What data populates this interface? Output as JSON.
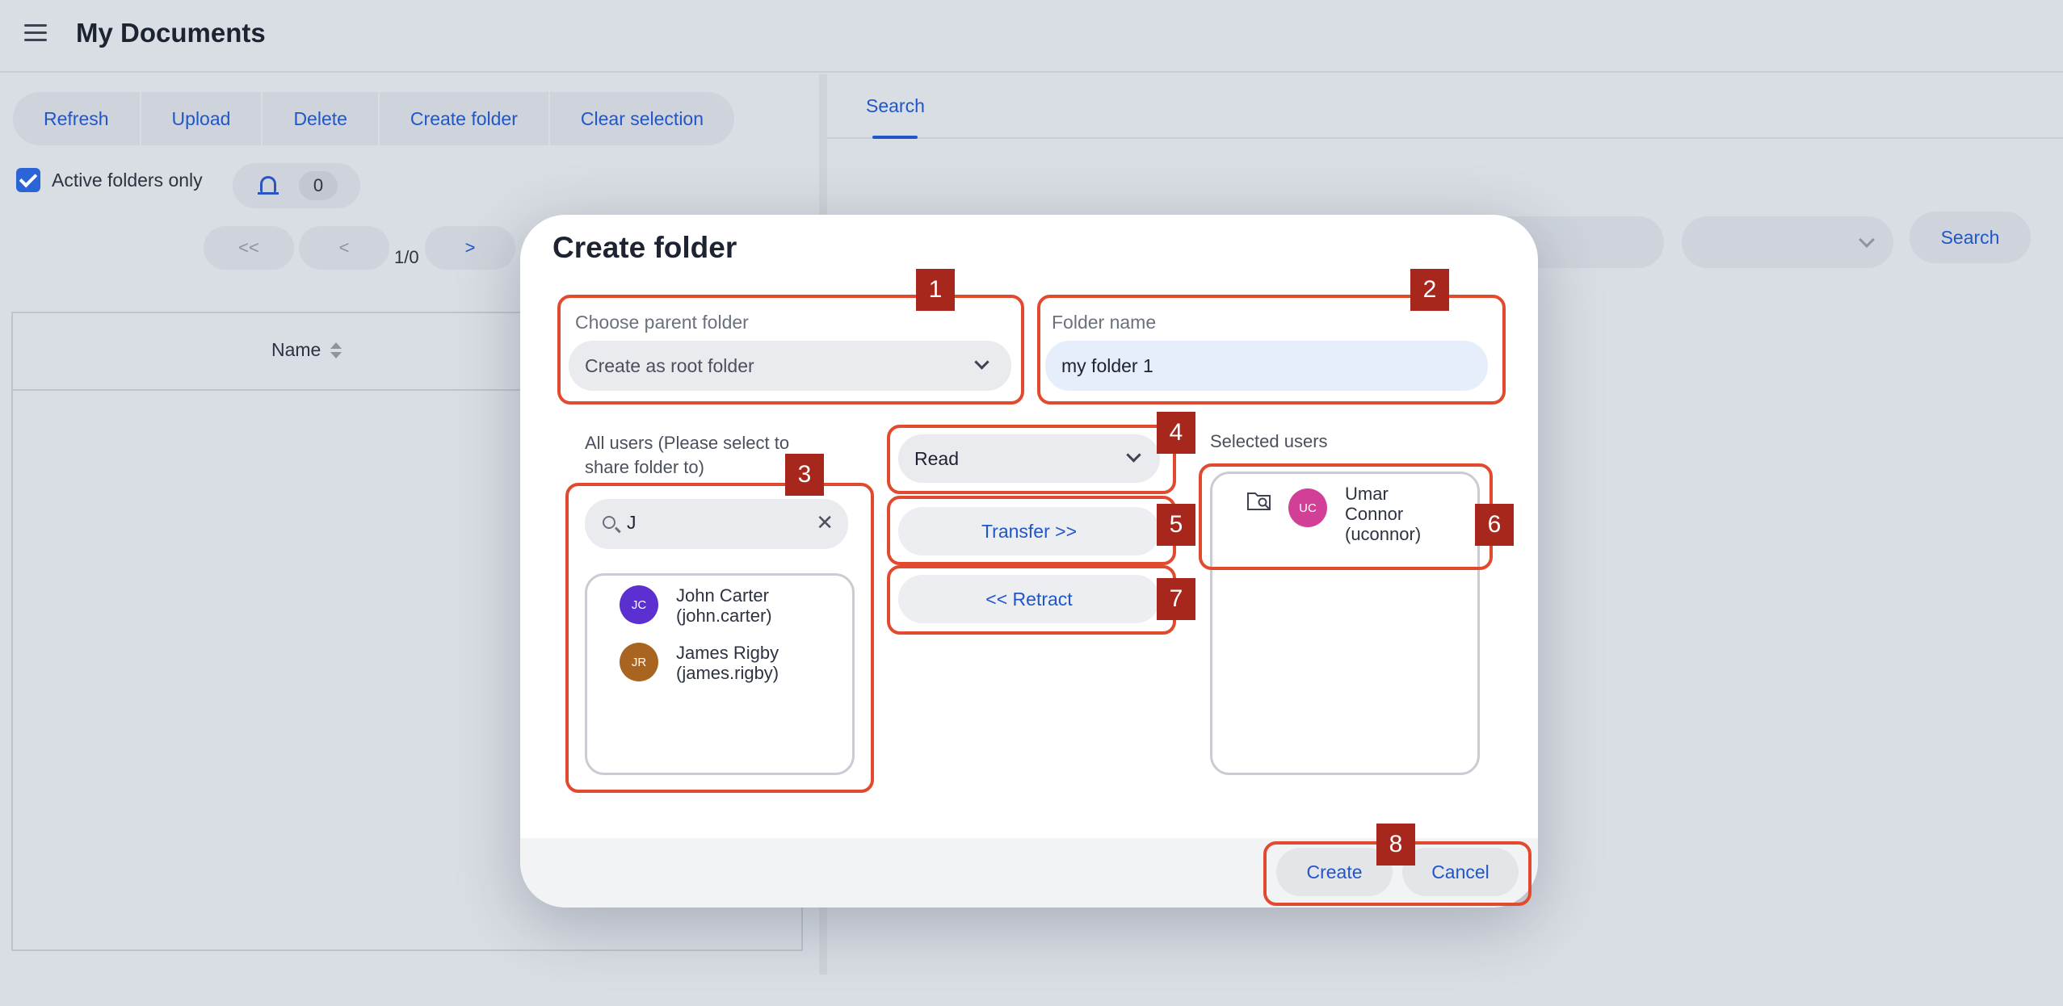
{
  "app": {
    "title": "My Documents"
  },
  "toolbar": {
    "buttons": [
      "Refresh",
      "Upload",
      "Delete",
      "Create folder",
      "Clear selection"
    ]
  },
  "filters": {
    "active_only_label": "Active folders only",
    "active_only_checked": true,
    "notification_count": "0"
  },
  "pagination": {
    "first": "<<",
    "prev": "<",
    "next": ">",
    "info": "1/0"
  },
  "table": {
    "columns": [
      "Name"
    ]
  },
  "search_panel": {
    "tab": "Search",
    "search_button": "Search"
  },
  "modal": {
    "title": "Create folder",
    "parent_folder": {
      "label": "Choose parent folder",
      "value": "Create as root folder"
    },
    "folder_name": {
      "label": "Folder name",
      "value": "my folder 1"
    },
    "all_users": {
      "label": "All users (Please select to share folder to)",
      "search_value": "J",
      "users": [
        {
          "initials": "JC",
          "name": "John Carter",
          "username": "(john.carter)",
          "color": "#5b2fd0"
        },
        {
          "initials": "JR",
          "name": "James Rigby",
          "username": "(james.rigby)",
          "color": "#a9641f"
        }
      ]
    },
    "permission": {
      "value": "Read"
    },
    "transfer_label": "Transfer >>",
    "retract_label": "<< Retract",
    "selected_users": {
      "label": "Selected users",
      "users": [
        {
          "initials": "UC",
          "first": "Umar",
          "last": "Connor",
          "username": "(uconnor)",
          "color": "#d23f97"
        }
      ]
    },
    "create_label": "Create",
    "cancel_label": "Cancel"
  },
  "annotations": [
    "1",
    "2",
    "3",
    "4",
    "5",
    "6",
    "7",
    "8"
  ],
  "colors": {
    "accent": "#2156c9",
    "annotation": "#e24a2f",
    "annotation_badge": "#a8271c"
  }
}
